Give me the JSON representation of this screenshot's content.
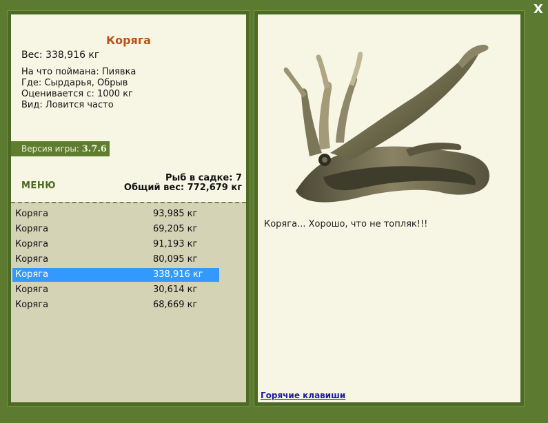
{
  "close_label": "X",
  "fish": {
    "title": "Коряга",
    "weight": "Вес: 338,916 кг",
    "caught_on": "На что поймана: Пиявка",
    "where": "Где: Сырдарья, Обрыв",
    "value": "Оценивается с: 1000 кг",
    "kind": "Вид: Ловится часто"
  },
  "version": {
    "label": "Версия игры:",
    "number": "3.7.6"
  },
  "menu_label": "МЕНЮ",
  "stats": {
    "count": "Рыб в садке: 7",
    "total": "Общий вес: 772,679 кг"
  },
  "catch_list": [
    {
      "name": "Коряга",
      "weight": "93,985 кг"
    },
    {
      "name": "Коряга",
      "weight": "69,205 кг"
    },
    {
      "name": "Коряга",
      "weight": "91,193 кг"
    },
    {
      "name": "Коряга",
      "weight": "80,095 кг"
    },
    {
      "name": "Коряга",
      "weight": "338,916 кг",
      "selected": true
    },
    {
      "name": "Коряга",
      "weight": "30,614 кг"
    },
    {
      "name": "Коряга",
      "weight": "68,669 кг"
    }
  ],
  "description": "Коряга... Хорошо, что не топляк!!!",
  "hotkeys_label": "Горячие клавиши",
  "colors": {
    "background": "#5c7a30",
    "panel": "#f7f6e4",
    "list_bg": "#d5d3b6",
    "title": "#b85418",
    "selection": "#3399ff",
    "link": "#1a1aa0"
  }
}
